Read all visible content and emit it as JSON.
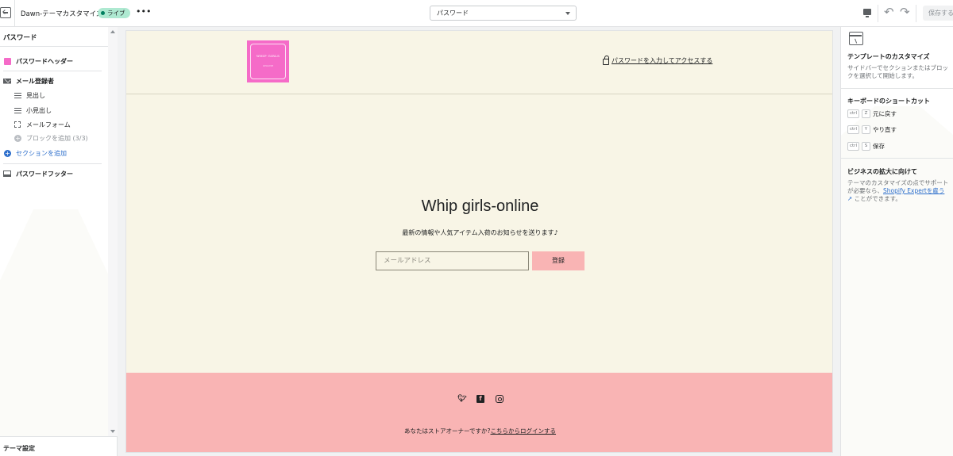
{
  "topbar": {
    "app_title": "Dawn-テーマカスタマイズ",
    "status_badge": "ライブ",
    "more": "•••",
    "template_select": "パスワード",
    "save": "保存する"
  },
  "sidebar": {
    "title": "パスワード",
    "header_section": "パスワードヘッダー",
    "email_section": "メール登録者",
    "blocks": [
      "見出し",
      "小見出し",
      "メールフォーム"
    ],
    "add_block": "ブロックを追加 (3/3)",
    "add_section": "セクションを追加",
    "footer_section": "パスワードフッター",
    "theme_settings": "テーマ設定"
  },
  "preview": {
    "logo_text": "WHIP GIRLS",
    "logo_sub": "ONLINE",
    "password_link": "パスワードを入力してアクセスする",
    "store_title": "Whip girls-online",
    "store_subtitle": "最新の情報や人気アイテム入荷のお知らせを送ります♪",
    "email_placeholder": "メールアドレス",
    "submit": "登録",
    "owner_question": "あなたはストアオーナーですか?",
    "owner_link": "こちらからログインする"
  },
  "right_panel": {
    "template_title": "テンプレートのカスタマイズ",
    "template_desc": "サイドバーでセクションまたはブロックを選択して開始します。",
    "shortcuts_title": "キーボードのショートカット",
    "shortcuts": [
      {
        "mod": "ctrl",
        "key": "Z",
        "label": "元に戻す"
      },
      {
        "mod": "ctrl",
        "key": "Y",
        "label": "やり直す"
      },
      {
        "mod": "ctrl",
        "key": "S",
        "label": "保存"
      }
    ],
    "grow_title": "ビジネスの拡大に向けて",
    "grow_desc_1": "テーマのカスタマイズの点でサポートが必要なら、",
    "grow_link": "Shopify Expertを雇う",
    "grow_desc_2": "ことができます。"
  },
  "colors": {
    "accent_pink": "#f56bc8",
    "footer_pink": "#f9b4b4",
    "preview_bg": "#f8f5e6",
    "live_badge": "#aee9d1",
    "link_blue": "#2c6ecb"
  }
}
